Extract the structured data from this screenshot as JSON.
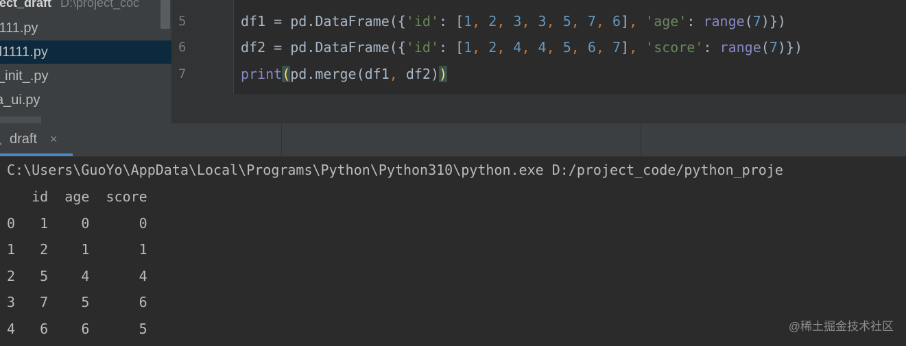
{
  "project": {
    "name": "ject_draft",
    "path": "D:\\project_coc"
  },
  "files": [
    {
      "label": "l111.py"
    },
    {
      "label": "d1111.py",
      "selected": true
    },
    {
      "label": "_init_.py"
    },
    {
      "label": "a_ui.py"
    }
  ],
  "editor": {
    "line_numbers": [
      "5",
      "6",
      "7"
    ],
    "lines": [
      "df1 = pd.DataFrame({'id': [1, 2, 3, 3, 5, 7, 6], 'age': range(7)})",
      "df2 = pd.DataFrame({'id': [1, 2, 4, 4, 5, 6, 7], 'score': range(7)})",
      "print(pd.merge(df1, df2))"
    ]
  },
  "run_tab": {
    "label": "draft",
    "close": "×"
  },
  "console": {
    "command": "C:\\Users\\GuoYo\\AppData\\Local\\Programs\\Python\\Python310\\python.exe D:/project_code/python_proje",
    "header": "   id  age  score",
    "rows": [
      "0   1    0      0",
      "1   2    1      1",
      "2   5    4      4",
      "3   7    5      6",
      "4   6    6      5"
    ]
  },
  "watermark": "@稀土掘金技术社区",
  "colors": {
    "accent": "#4a88c7",
    "selection": "#0d293e",
    "string": "#6a8759",
    "number": "#6897bb",
    "builtin": "#8888c6"
  }
}
